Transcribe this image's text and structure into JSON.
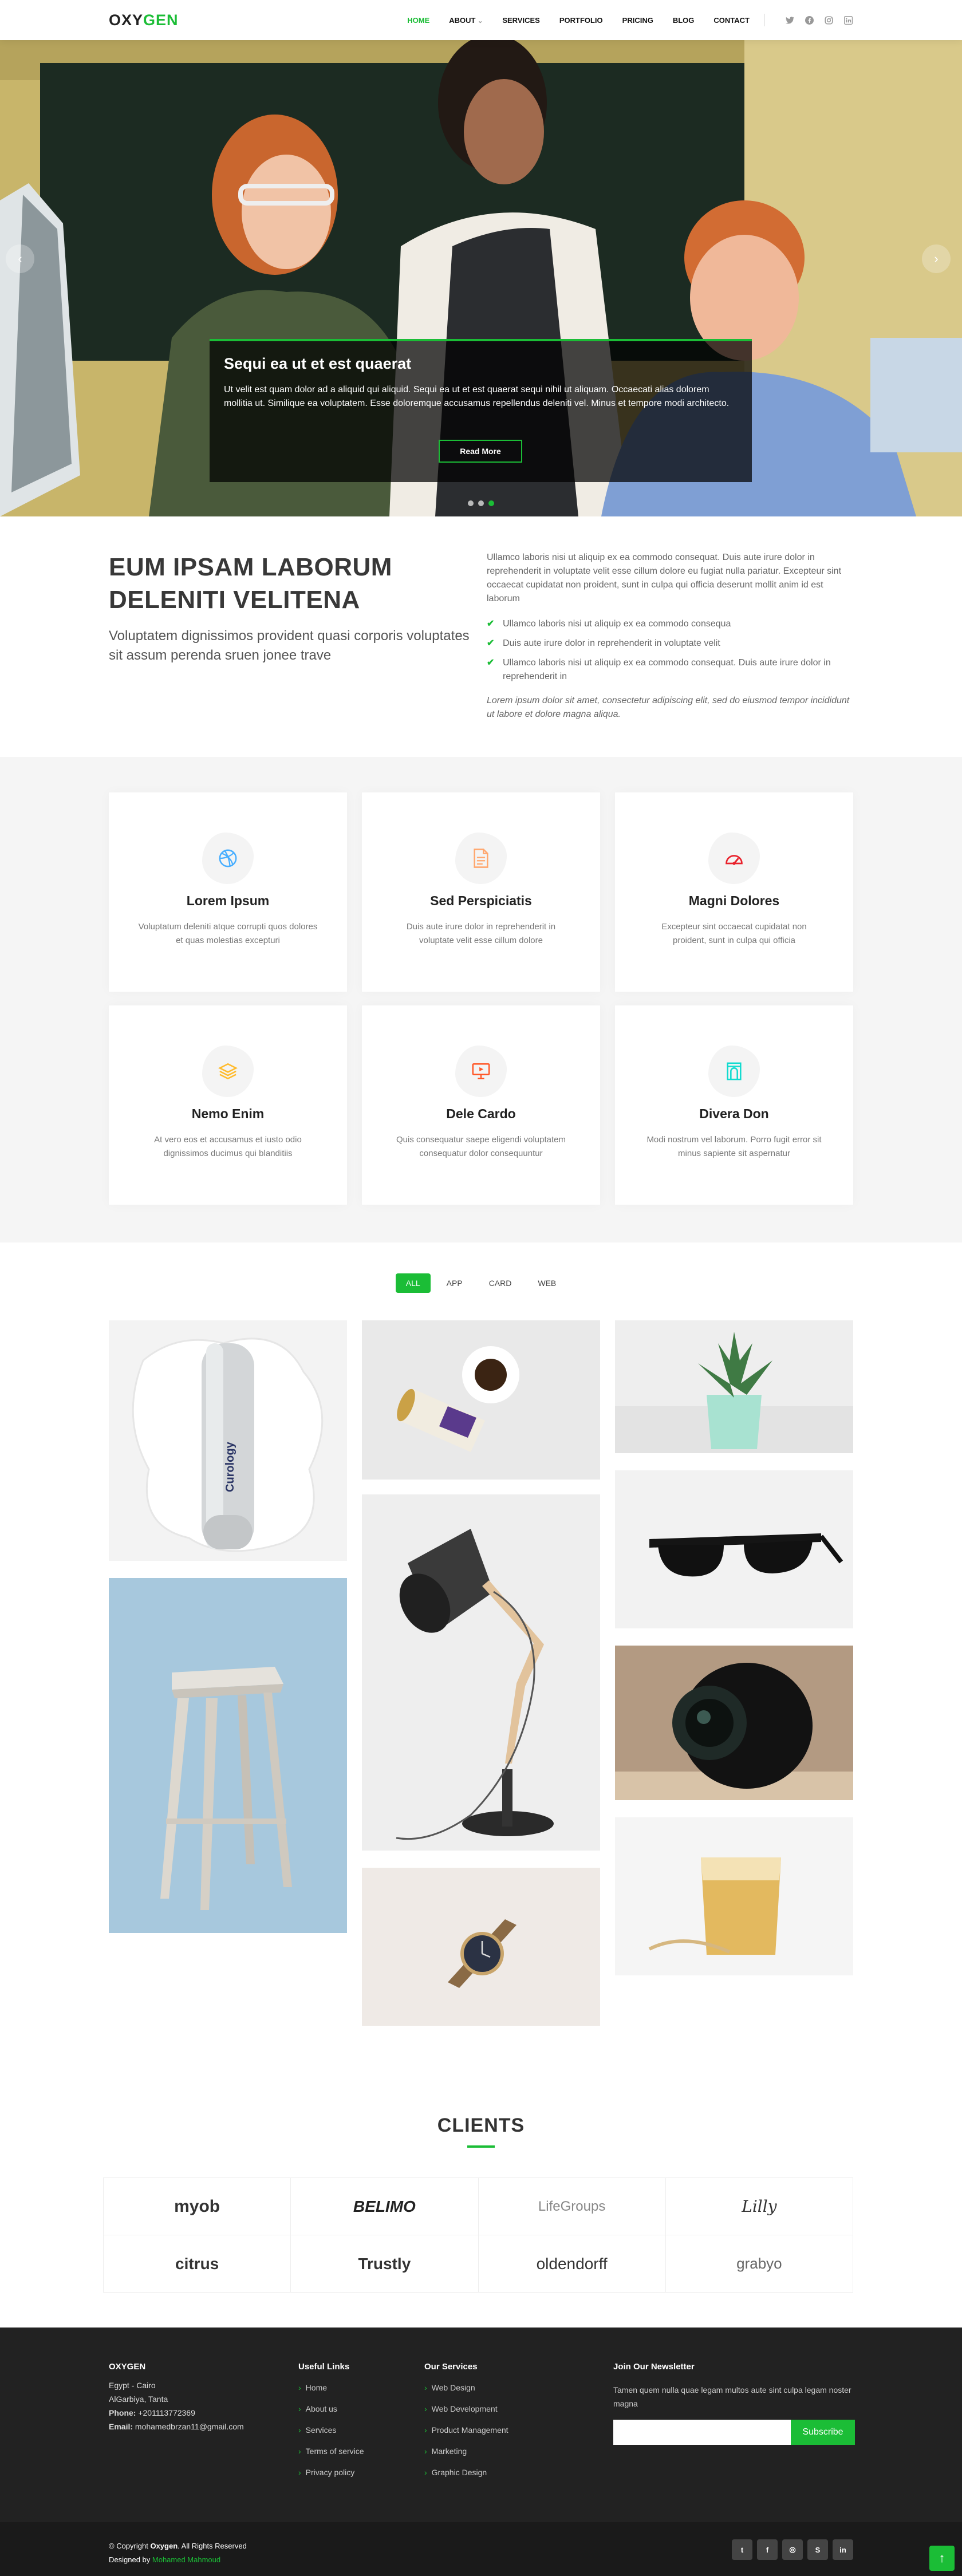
{
  "header": {
    "logo_a": "OXY",
    "logo_b": "GEN",
    "nav": [
      "HOME",
      "ABOUT",
      "SERVICES",
      "PORTFOLIO",
      "PRICING",
      "BLOG",
      "CONTACT"
    ],
    "about_chevron": "⌄",
    "social_icons": [
      "twitter-icon",
      "facebook-icon",
      "instagram-icon",
      "linkedin-icon"
    ]
  },
  "hero": {
    "title": "Sequi ea ut et est quaerat",
    "text": "Ut velit est quam dolor ad a aliquid qui aliquid. Sequi ea ut et est quaerat sequi nihil ut aliquam. Occaecati alias dolorem mollitia ut. Similique ea voluptatem. Esse doloremque accusamus repellendus deleniti vel. Minus et tempore modi architecto.",
    "button": "Read More",
    "prev": "‹",
    "next": "›",
    "active_slide": 3
  },
  "about": {
    "title": "EUM IPSAM LABORUM DELENITI VELITENA",
    "subtitle": "Voluptatem dignissimos provident quasi corporis voluptates sit assum perenda sruen jonee trave",
    "intro": "Ullamco laboris nisi ut aliquip ex ea commodo consequat. Duis aute irure dolor in reprehenderit in voluptate velit esse cillum dolore eu fugiat nulla pariatur. Excepteur sint occaecat cupidatat non proident, sunt in culpa qui officia deserunt mollit anim id est laborum",
    "checks": [
      "Ullamco laboris nisi ut aliquip ex ea commodo consequa",
      "Duis aute irure dolor in reprehenderit in voluptate velit",
      "Ullamco laboris nisi ut aliquip ex ea commodo consequat. Duis aute irure dolor in reprehenderit in"
    ],
    "check_glyph": "✔",
    "outro": "Lorem ipsum dolor sit amet, consectetur adipiscing elit, sed do eiusmod tempor incididunt ut labore et dolore magna aliqua."
  },
  "services": [
    {
      "title": "Lorem Ipsum",
      "text": "Voluptatum deleniti atque corrupti quos dolores et quas molestias excepturi",
      "icon": "dribbble-icon",
      "color": "#47aeff"
    },
    {
      "title": "Sed Perspiciatis",
      "text": "Duis aute irure dolor in reprehenderit in voluptate velit esse cillum dolore",
      "icon": "file-icon",
      "color": "#ffa76e"
    },
    {
      "title": "Magni Dolores",
      "text": "Excepteur sint occaecat cupidatat non proident, sunt in culpa qui officia",
      "icon": "speedometer-icon",
      "color": "#e9222c"
    },
    {
      "title": "Nemo Enim",
      "text": "At vero eos et accusamus et iusto odio dignissimos ducimus qui blanditiis",
      "icon": "layers-icon",
      "color": "#ffbb2c"
    },
    {
      "title": "Dele Cardo",
      "text": "Quis consequatur saepe eligendi voluptatem consequatur dolor consequuntur",
      "icon": "slideshow-icon",
      "color": "#ff5828"
    },
    {
      "title": "Divera Don",
      "text": "Modi nostrum vel laborum. Porro fugit error sit minus sapiente sit aspernatur",
      "icon": "arch-icon",
      "color": "#11dbcf"
    }
  ],
  "portfolio": {
    "filters": [
      "ALL",
      "APP",
      "CARD",
      "WEB"
    ],
    "items": [
      "cosmetic-bottle",
      "tin-and-coffee",
      "succulent-plant",
      "sunglasses",
      "stool",
      "desk-lamp",
      "camera-lens",
      "watch",
      "glass-of-drink"
    ],
    "bottle_label": "Curology"
  },
  "clients": {
    "title": "CLIENTS",
    "logos": [
      "myob",
      "BELIMO",
      "LifeGroups",
      "Lilly",
      "citrus",
      "Trustly",
      "oldendorff",
      "grabyo"
    ]
  },
  "footer": {
    "brand": "OXYGEN",
    "address1": "Egypt - Cairo",
    "address2": "AlGarbiya, Tanta",
    "phone_label": "Phone:",
    "phone": " +201113772369",
    "email_label": "Email:",
    "email": " mohamedbrzan11@gmail.com",
    "useful_title": "Useful Links",
    "useful": [
      "Home",
      "About us",
      "Services",
      "Terms of service",
      "Privacy policy"
    ],
    "services_title": "Our Services",
    "services": [
      "Web Design",
      "Web Development",
      "Product Management",
      "Marketing",
      "Graphic Design"
    ],
    "newsletter_title": "Join Our Newsletter",
    "newsletter_text": "Tamen quem nulla quae legam multos aute sint culpa legam noster magna",
    "subscribe": "Subscribe",
    "chev": "›"
  },
  "bottom": {
    "copy_a": "© Copyright ",
    "copy_brand": "Oxygen",
    "copy_b": ". All Rights Reserved",
    "designed": "Designed by ",
    "designer": "Mohamed Mahmoud",
    "social": [
      "t",
      "f",
      "◎",
      "S",
      "in"
    ],
    "back_top": "↑"
  },
  "colors": {
    "accent": "#1bbd36",
    "footer": "#222222"
  }
}
